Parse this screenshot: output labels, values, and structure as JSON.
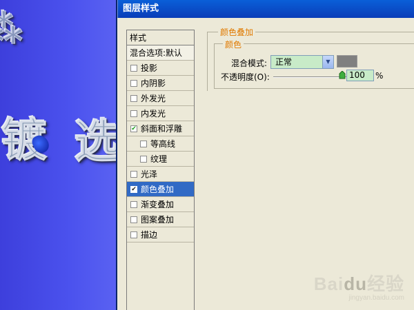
{
  "dialog": {
    "title": "图层样式"
  },
  "style_list": {
    "header": "样式",
    "blend_options": "混合选项:默认",
    "items": [
      {
        "label": "投影",
        "checked": false
      },
      {
        "label": "内阴影",
        "checked": false
      },
      {
        "label": "外发光",
        "checked": false
      },
      {
        "label": "内发光",
        "checked": false
      },
      {
        "label": "斜面和浮雕",
        "checked": true
      },
      {
        "label": "等高线",
        "checked": false,
        "sub": true
      },
      {
        "label": "纹理",
        "checked": false,
        "sub": true
      },
      {
        "label": "光泽",
        "checked": false
      },
      {
        "label": "颜色叠加",
        "checked": true,
        "selected": true
      },
      {
        "label": "渐变叠加",
        "checked": false
      },
      {
        "label": "图案叠加",
        "checked": false
      },
      {
        "label": "描边",
        "checked": false
      }
    ]
  },
  "panel": {
    "group_title": "颜色叠加",
    "subgroup_title": "颜色",
    "blend_mode_label": "混合模式:",
    "blend_mode_value": "正常",
    "opacity_label": "不透明度(O):",
    "opacity_value": "100",
    "opacity_unit": "%",
    "opacity_level": 1.0,
    "overlay_color": "#808080"
  },
  "canvas": {
    "glyphs": [
      "镀",
      "选"
    ]
  },
  "watermark": {
    "logo_text": "Bai",
    "logo_accent": "du",
    "logo_suffix": "经验",
    "site": "jingyan.baidu.com"
  },
  "colors": {
    "selection": "#316ac5",
    "title_bar": "#0a3db8",
    "accent_title": "#e07a00",
    "input_bg": "#c8ebc8"
  }
}
